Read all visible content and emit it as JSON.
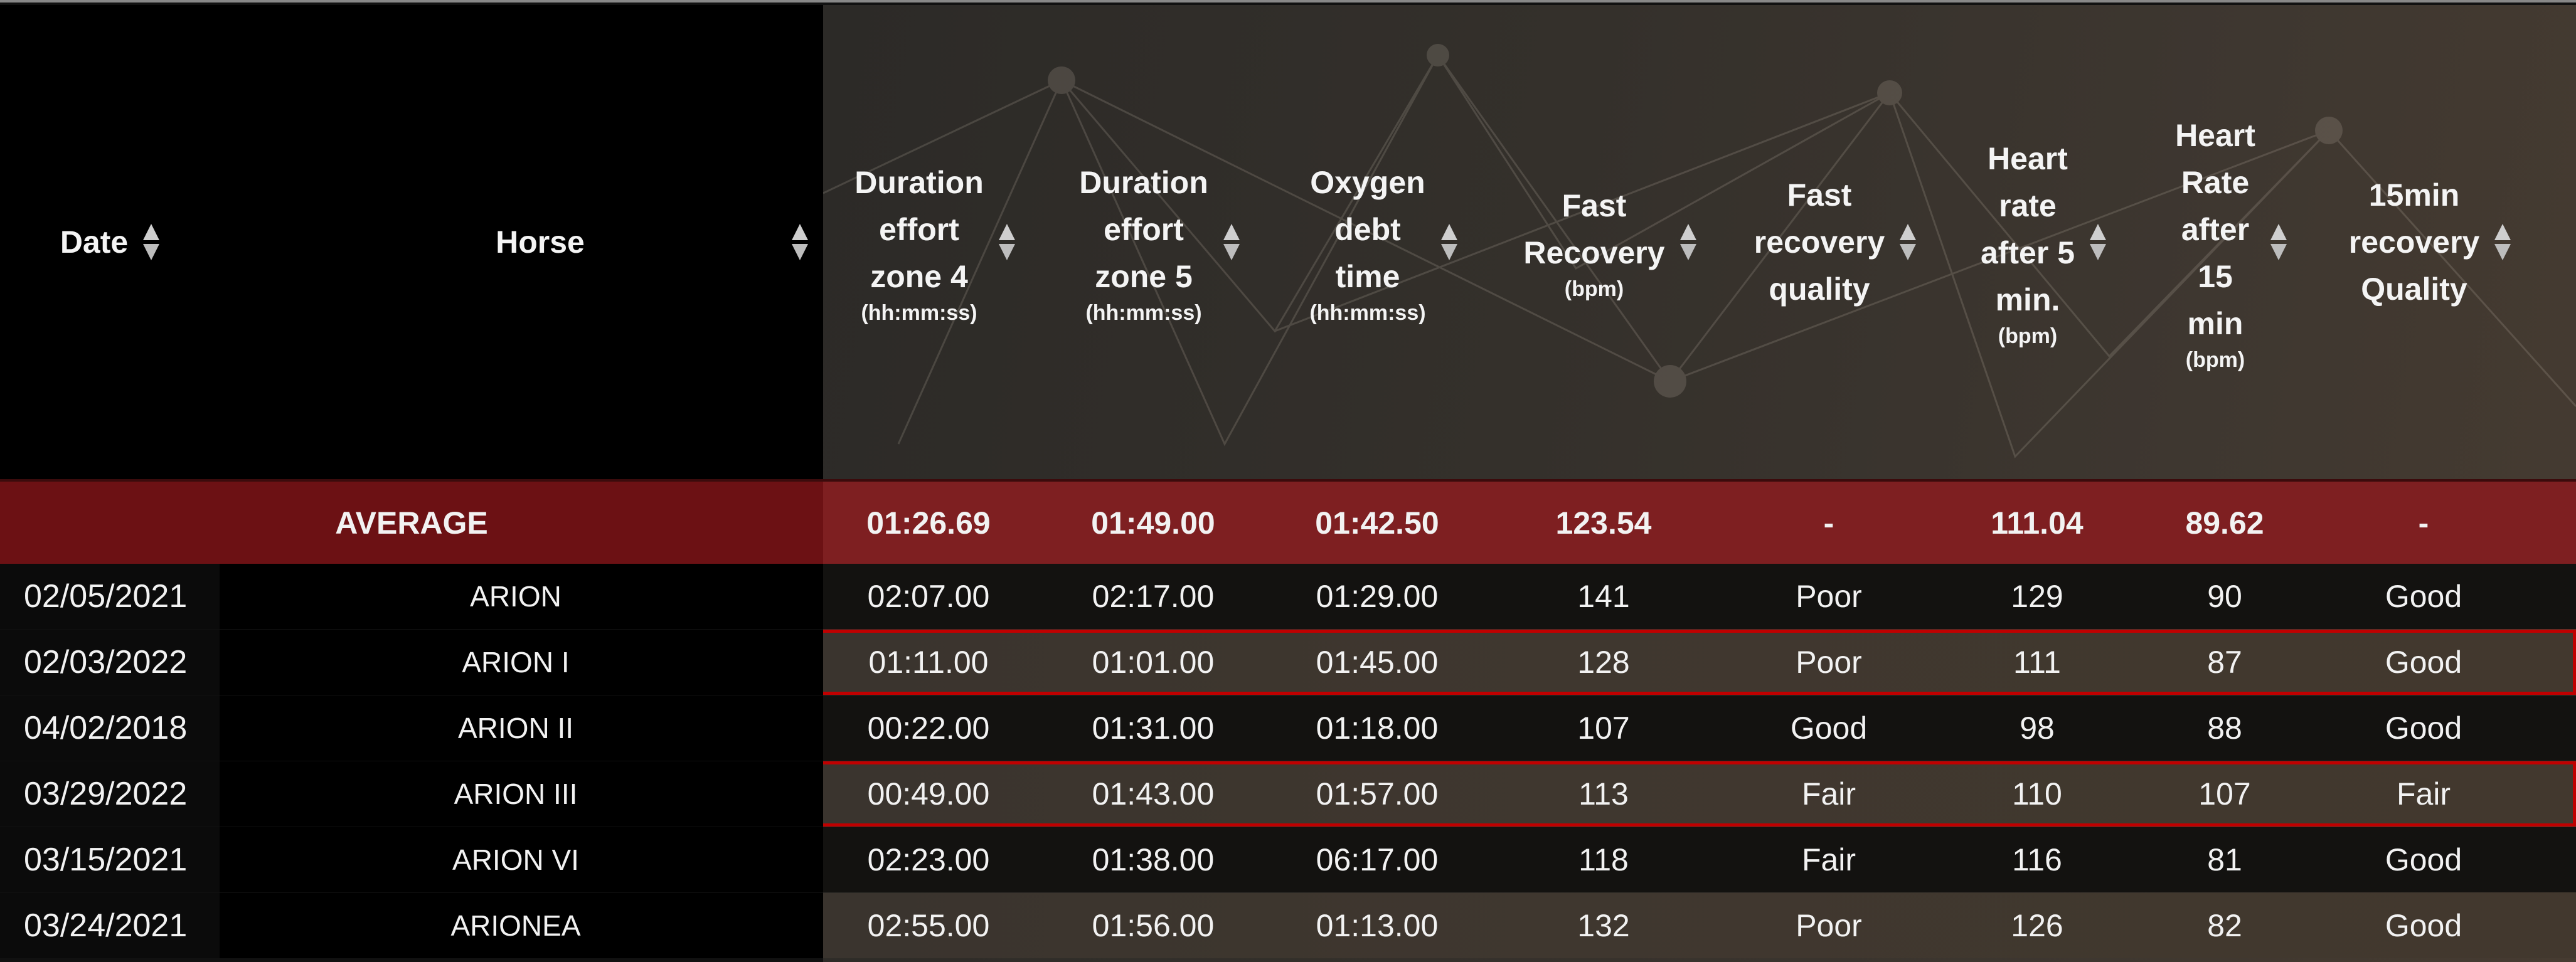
{
  "table": {
    "columns": [
      {
        "key": "date",
        "label": "Date",
        "unit": ""
      },
      {
        "key": "horse",
        "label": "Horse",
        "unit": ""
      },
      {
        "key": "dur_z4",
        "label": "Duration effort zone 4",
        "lines": [
          "Duration",
          "effort",
          "zone 4"
        ],
        "unit": "(hh:mm:ss)"
      },
      {
        "key": "dur_z5",
        "label": "Duration effort zone 5",
        "lines": [
          "Duration",
          "effort",
          "zone 5"
        ],
        "unit": "(hh:mm:ss)"
      },
      {
        "key": "oxy",
        "label": "Oxygen debt time",
        "lines": [
          "Oxygen",
          "debt",
          "time"
        ],
        "unit": "(hh:mm:ss)"
      },
      {
        "key": "fast_rec",
        "label": "Fast Recovery",
        "lines": [
          "Fast",
          "Recovery"
        ],
        "unit": "(bpm)"
      },
      {
        "key": "fast_rec_q",
        "label": "Fast recovery quality",
        "lines": [
          "Fast",
          "recovery",
          "quality"
        ],
        "unit": ""
      },
      {
        "key": "hr5",
        "label": "Heart rate after 5 min.",
        "lines": [
          "Heart",
          "rate",
          "after 5",
          "min."
        ],
        "unit": "(bpm)"
      },
      {
        "key": "hr15",
        "label": "Heart Rate after 15 min",
        "lines": [
          "Heart",
          "Rate",
          "after",
          "15",
          "min"
        ],
        "unit": "(bpm)"
      },
      {
        "key": "q15",
        "label": "15min recovery Quality",
        "lines": [
          "15min",
          "recovery",
          "Quality"
        ],
        "unit": ""
      }
    ],
    "average": {
      "label": "AVERAGE",
      "values": [
        "01:26.69",
        "01:49.00",
        "01:42.50",
        "123.54",
        "-",
        "111.04",
        "89.62",
        "-"
      ]
    },
    "rows": [
      {
        "date": "02/05/2021",
        "horse": "ARION",
        "values": [
          "02:07.00",
          "02:17.00",
          "01:29.00",
          "141",
          "Poor",
          "129",
          "90",
          "Good"
        ],
        "selected": false,
        "shade": "dark"
      },
      {
        "date": "02/03/2022",
        "horse": "ARION I",
        "values": [
          "01:11.00",
          "01:01.00",
          "01:45.00",
          "128",
          "Poor",
          "111",
          "87",
          "Good"
        ],
        "selected": true,
        "shade": "light"
      },
      {
        "date": "04/02/2018",
        "horse": "ARION II",
        "values": [
          "00:22.00",
          "01:31.00",
          "01:18.00",
          "107",
          "Good",
          "98",
          "88",
          "Good"
        ],
        "selected": false,
        "shade": "dark"
      },
      {
        "date": "03/29/2022",
        "horse": "ARION III",
        "values": [
          "00:49.00",
          "01:43.00",
          "01:57.00",
          "113",
          "Fair",
          "110",
          "107",
          "Fair"
        ],
        "selected": true,
        "shade": "light"
      },
      {
        "date": "03/15/2021",
        "horse": "ARION VI",
        "values": [
          "02:23.00",
          "01:38.00",
          "06:17.00",
          "118",
          "Fair",
          "116",
          "81",
          "Good"
        ],
        "selected": false,
        "shade": "dark"
      },
      {
        "date": "03/24/2021",
        "horse": "ARIONEA",
        "values": [
          "02:55.00",
          "01:56.00",
          "01:13.00",
          "132",
          "Poor",
          "126",
          "82",
          "Good"
        ],
        "selected": false,
        "shade": "light"
      }
    ]
  },
  "colors": {
    "average_bg": "#7e1f21",
    "selection_border": "#c00000",
    "header_left_bg": "#000000"
  },
  "icons": {
    "sort": "sort-updown-icon"
  }
}
